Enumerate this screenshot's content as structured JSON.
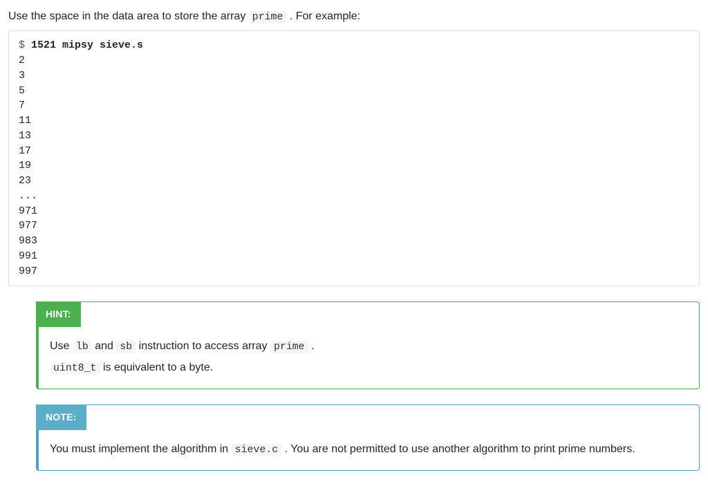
{
  "intro": {
    "before_code": "Use the space in the data area to store the array ",
    "code": "prime",
    "after_code": " . For example:"
  },
  "terminal": {
    "prompt": "$",
    "command": "1521 mipsy sieve.s",
    "output_lines": [
      "2",
      "3",
      "5",
      "7",
      "11",
      "13",
      "17",
      "19",
      "23",
      "...",
      "971",
      "977",
      "983",
      "991",
      "997"
    ]
  },
  "hint": {
    "label": "HINT:",
    "line1": {
      "t1": "Use ",
      "c1": "lb",
      "t2": " and ",
      "c2": "sb",
      "t3": " instruction to access array ",
      "c3": "prime",
      "t4": " ."
    },
    "line2": {
      "c1": "uint8_t",
      "t1": " is equivalent to a byte."
    }
  },
  "note": {
    "label": "NOTE:",
    "line1": {
      "t1": "You must implement the algorithm in ",
      "c1": "sieve.c",
      "t2": " . You are not permitted to use another algorithm to print prime numbers."
    }
  }
}
